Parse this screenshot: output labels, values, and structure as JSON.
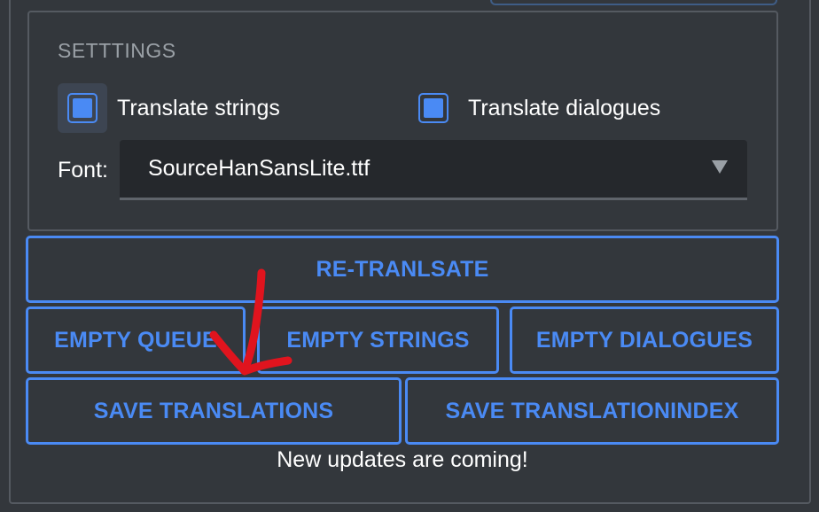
{
  "settings": {
    "title": "SETTTINGS",
    "translate_strings_label": "Translate strings",
    "translate_strings_checked": true,
    "translate_dialogues_label": "Translate dialogues",
    "translate_dialogues_checked": true,
    "font_label": "Font:",
    "font_value": "SourceHanSansLite.ttf"
  },
  "buttons": {
    "retranslate": "RE-TRANLSATE",
    "empty_queue": "EMPTY QUEUE",
    "empty_strings": "EMPTY STRINGS",
    "empty_dialogues": "EMPTY DIALOGUES",
    "save_translations": "SAVE TRANSLATIONS",
    "save_translationindex": "SAVE TRANSLATIONINDEX"
  },
  "footer": {
    "message": "New updates are coming!"
  },
  "annotation": {
    "icon": "red-hand-drawn-arrow-icon",
    "color": "#e0141e"
  },
  "colors": {
    "accent": "#4a8af4",
    "background": "#33373c",
    "select_background": "#25282c"
  }
}
